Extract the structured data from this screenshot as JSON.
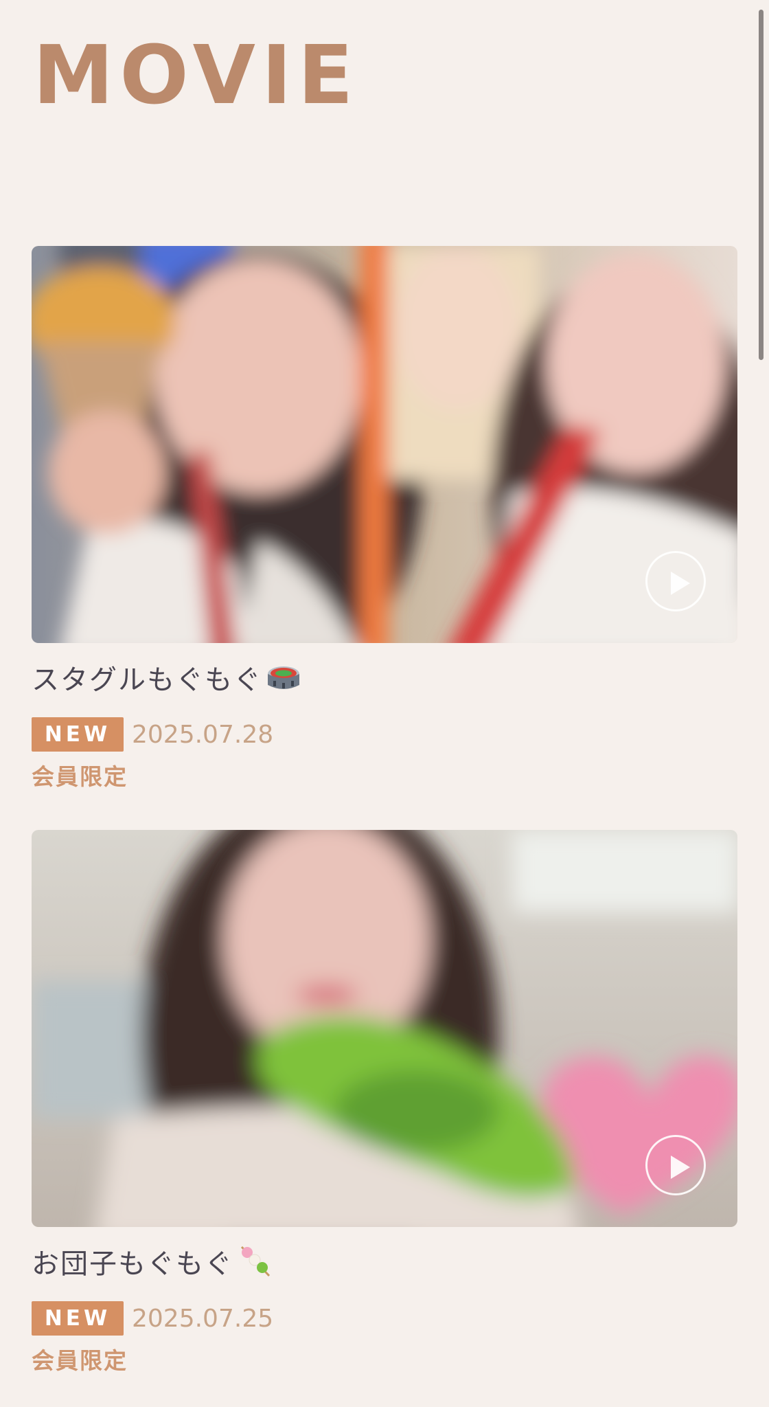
{
  "page": {
    "title": "MOVIE",
    "accent_color": "#bb8a6c",
    "background_color": "#f6f0ec"
  },
  "movies": [
    {
      "title": "スタグルもぐもぐ",
      "title_emoji": "stadium-icon",
      "badge": "NEW",
      "date": "2025.07.28",
      "access": "会員限定",
      "thumbnail": "blurred-selfie-two-girls-stadium-food",
      "play_icon": "play-icon"
    },
    {
      "title": "お団子もぐもぐ",
      "title_emoji": "dango-icon",
      "badge": "NEW",
      "date": "2025.07.25",
      "access": "会員限定",
      "thumbnail": "blurred-selfie-girl-green-dango-pink-heart",
      "play_icon": "play-icon"
    }
  ]
}
